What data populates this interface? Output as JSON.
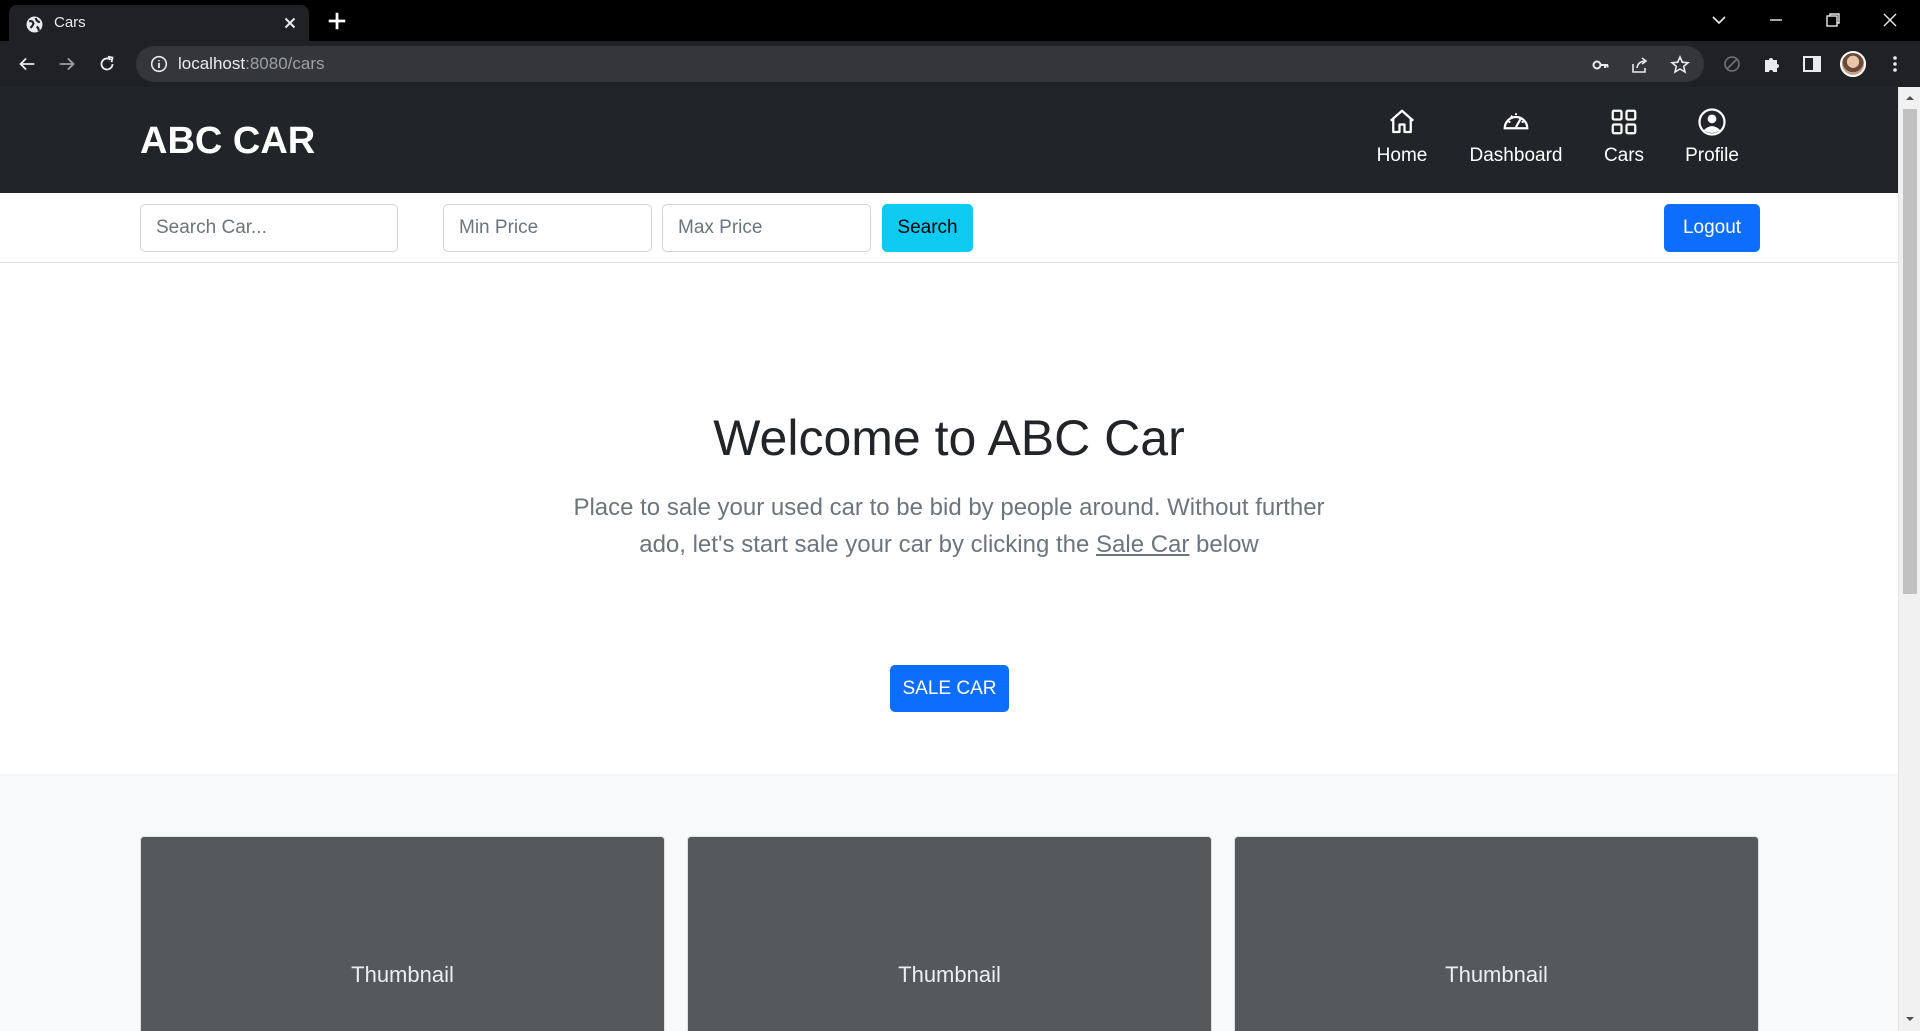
{
  "browser": {
    "tab_title": "Cars",
    "url_host": "localhost",
    "url_path": ":8080/cars"
  },
  "site": {
    "brand": "ABC CAR",
    "nav": [
      {
        "label": "Home",
        "icon": "house-icon"
      },
      {
        "label": "Dashboard",
        "icon": "speedometer-icon"
      },
      {
        "label": "Cars",
        "icon": "grid-icon"
      },
      {
        "label": "Profile",
        "icon": "person-circle-icon"
      }
    ]
  },
  "search": {
    "car_placeholder": "Search Car...",
    "min_placeholder": "Min Price",
    "max_placeholder": "Max Price",
    "search_label": "Search",
    "logout_label": "Logout"
  },
  "hero": {
    "title": "Welcome to ABC Car",
    "lead_part1": "Place to sale your used car to be bid by people around. Without further ado, let's start sale your car by clicking the ",
    "lead_link": "Sale Car",
    "lead_part2": " below",
    "button_label": "SALE CAR"
  },
  "cards": [
    {
      "label": "Thumbnail"
    },
    {
      "label": "Thumbnail"
    },
    {
      "label": "Thumbnail"
    }
  ],
  "colors": {
    "navbar": "#212529",
    "primary": "#0d6efd",
    "info": "#0dcaf0",
    "thumbnail": "#55595c"
  }
}
